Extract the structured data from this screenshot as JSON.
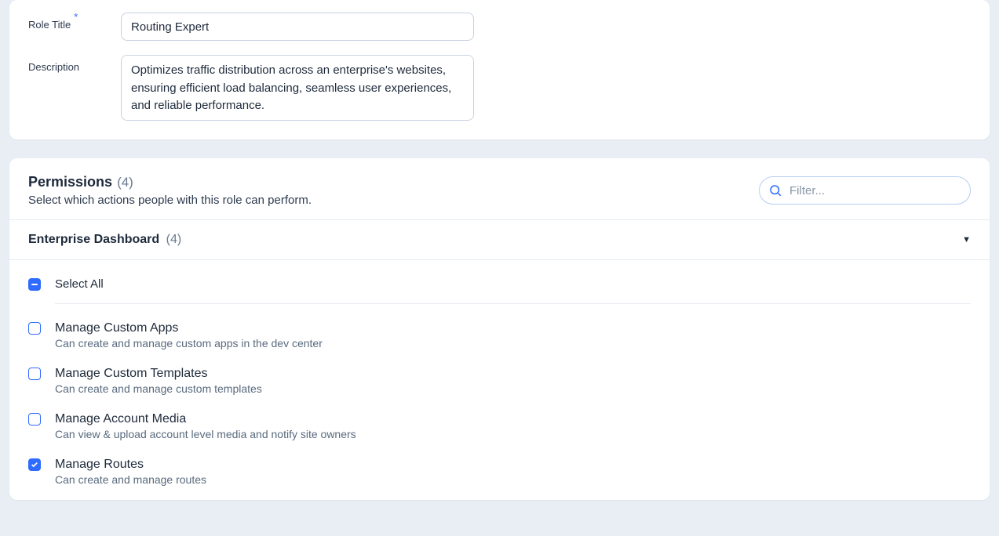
{
  "role": {
    "title_label": "Role Title",
    "title_value": "Routing Expert",
    "description_label": "Description",
    "description_value": "Optimizes traffic distribution across an enterprise's websites, ensuring efficient load balancing, seamless user experiences, and reliable performance."
  },
  "permissions": {
    "title": "Permissions",
    "count": "(4)",
    "subtitle": "Select which actions people with this role can perform.",
    "filter_placeholder": "Filter...",
    "group": {
      "title": "Enterprise Dashboard",
      "count": "(4)"
    },
    "select_all_label": "Select All",
    "items": [
      {
        "title": "Manage Custom Apps",
        "desc": "Can create and manage custom apps in the dev center",
        "checked": false
      },
      {
        "title": "Manage Custom Templates",
        "desc": "Can create and manage custom templates",
        "checked": false
      },
      {
        "title": "Manage Account Media",
        "desc": "Can view & upload account level media and notify site owners",
        "checked": false
      },
      {
        "title": "Manage Routes",
        "desc": "Can create and manage routes",
        "checked": true
      }
    ]
  }
}
